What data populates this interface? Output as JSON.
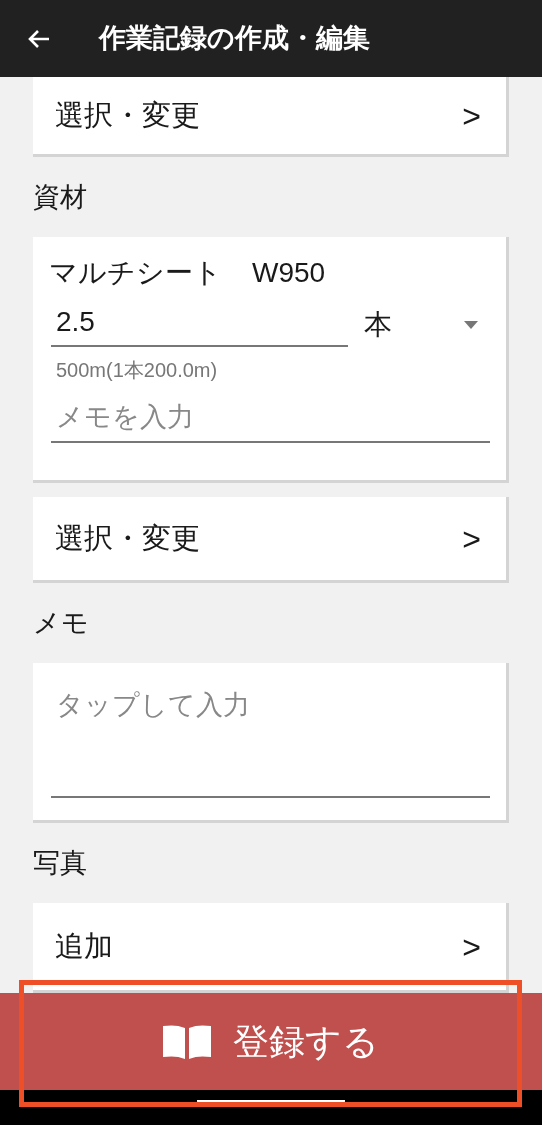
{
  "app_bar": {
    "title": "作業記録の作成・編集"
  },
  "top_select": {
    "label": "選択・変更",
    "chevron": ">"
  },
  "sections": [
    {
      "kind": "material",
      "title": "資材",
      "material": {
        "name": "マルチシート",
        "spec": "W950",
        "quantity": "2.5",
        "unit": "本",
        "note": "500m(1本200.0m)",
        "memo_placeholder": "メモを入力"
      },
      "select": {
        "label": "選択・変更",
        "chevron": ">"
      }
    },
    {
      "kind": "memo",
      "title": "メモ",
      "placeholder": "タップして入力"
    },
    {
      "kind": "photo",
      "title": "写真",
      "action": {
        "label": "追加",
        "chevron": ">"
      }
    }
  ],
  "submit_button": {
    "label": "登録する"
  }
}
